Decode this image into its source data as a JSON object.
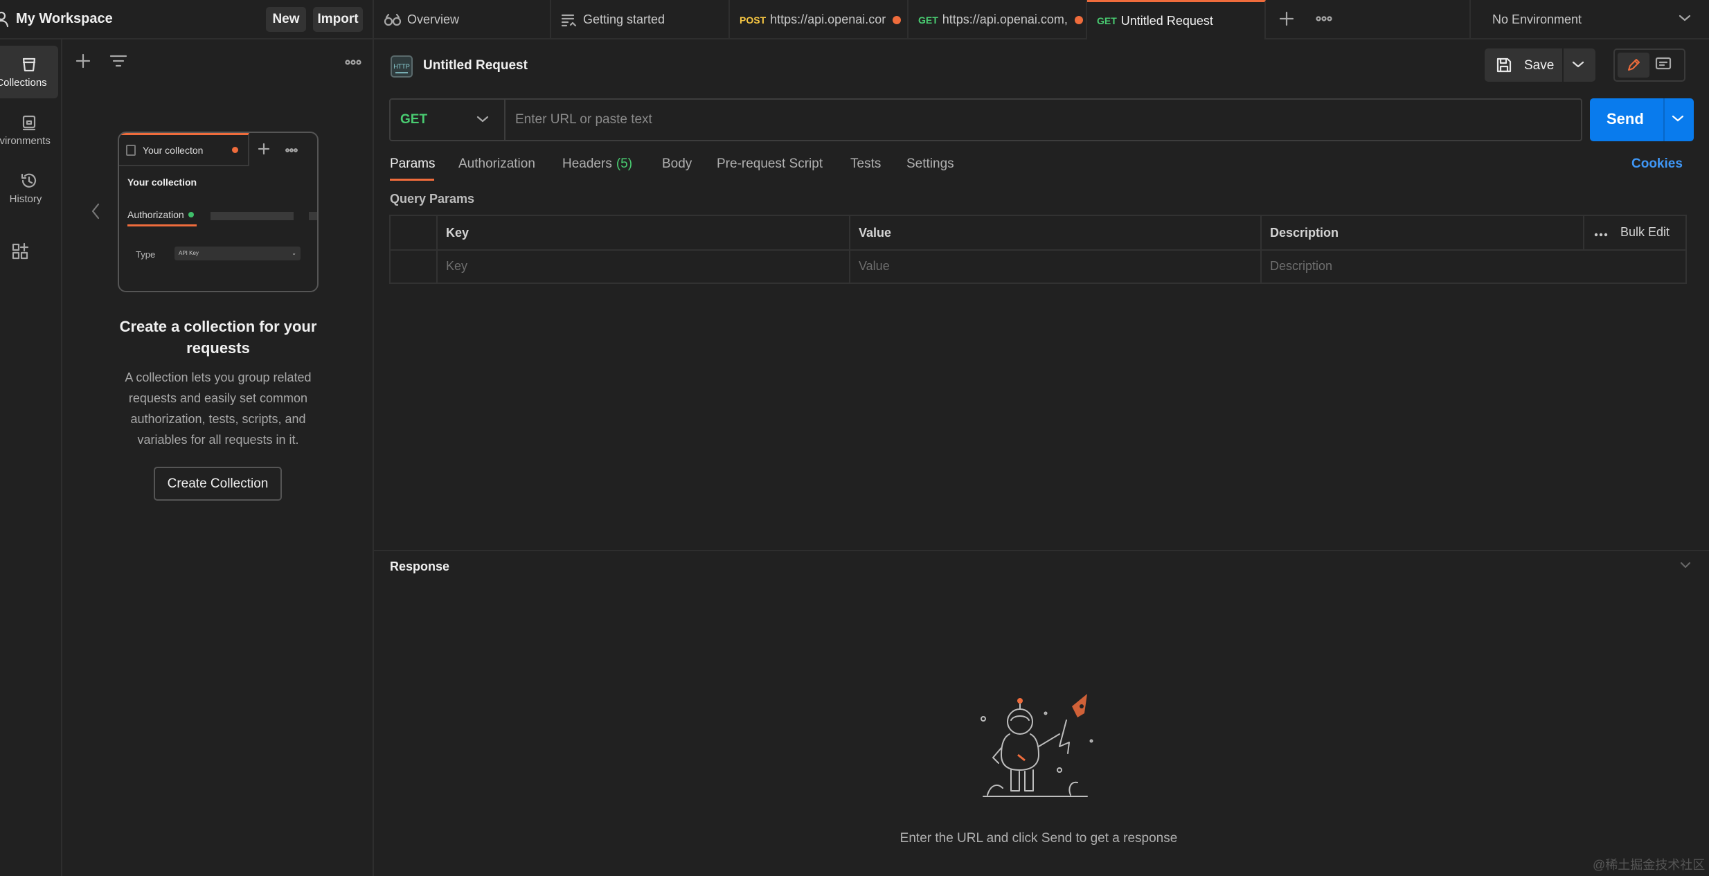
{
  "workspace": {
    "name": "My Workspace",
    "new_label": "New",
    "import_label": "Import"
  },
  "tabs": [
    {
      "method": "",
      "label": "Overview",
      "unsaved": false
    },
    {
      "method": "",
      "label": "Getting started",
      "unsaved": false
    },
    {
      "method": "POST",
      "label": "https://api.openai.cor",
      "unsaved": true
    },
    {
      "method": "GET",
      "label": "https://api.openai.com,",
      "unsaved": true
    },
    {
      "method": "GET",
      "label": "Untitled Request",
      "unsaved": false,
      "active": true
    }
  ],
  "environment": {
    "selected": "No Environment"
  },
  "rail": {
    "collections": "Collections",
    "environments": "Environments",
    "history": "History"
  },
  "collections_pane": {
    "card": {
      "tab_label": "Your collecton",
      "title": "Your collection",
      "auth_label": "Authorization",
      "type_label": "Type",
      "type_value": "API Key"
    },
    "heading": "Create a collection for your requests",
    "description": "A collection lets you group related requests and easily set common authorization, tests, scripts, and variables for all requests in it.",
    "create_button": "Create Collection"
  },
  "request": {
    "title": "Untitled Request",
    "save_label": "Save",
    "method": "GET",
    "url_value": "",
    "url_placeholder": "Enter URL or paste text",
    "send_label": "Send",
    "tabs": {
      "params": "Params",
      "authorization": "Authorization",
      "headers": "Headers",
      "headers_count": "(5)",
      "body": "Body",
      "pre_request": "Pre-request Script",
      "tests": "Tests",
      "settings": "Settings"
    },
    "cookies_label": "Cookies",
    "query_params_label": "Query Params",
    "table": {
      "columns": [
        "Key",
        "Value",
        "Description"
      ],
      "placeholders": [
        "Key",
        "Value",
        "Description"
      ],
      "bulk_edit": "Bulk Edit"
    }
  },
  "response": {
    "label": "Response",
    "hint": "Enter the URL and click Send to get a response"
  },
  "watermark": "@稀土掘金技术社区",
  "colors": {
    "accent": "#ef6c3c",
    "send_blue": "#097bed",
    "method_get": "#49cc71",
    "method_post": "#f5c542",
    "link_blue": "#3f97f6"
  }
}
